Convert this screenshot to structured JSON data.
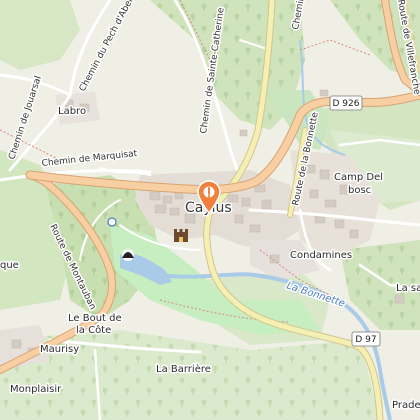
{
  "places": {
    "town": "Caylus",
    "labro": "Labro",
    "camp_del_bosc_1": "Camp Del",
    "camp_del_bosc_2": "bosc",
    "condamines": "Condamines",
    "le_bout_1": "Le Bout de",
    "le_bout_2": "la Côte",
    "maurisy": "Maurisy",
    "monplaisir": "Monplaisir",
    "la_barriere": "La Barrière",
    "prade": "Prade",
    "la_sa": "La sa",
    "que": "que"
  },
  "roads": {
    "d926": "D 926",
    "d97": "D 97",
    "chemin_marquisat": "Chemin de Marquisat",
    "chemin_jouarsal": "Chemin de Jouarsal",
    "chemin_pech": "Chemin du Pech d'Abel",
    "chemin_catherine": "Chemin de Sainte-Catherine",
    "route_bonnette": "Route de la Bonnette",
    "route_montauban": "Route de Montauban",
    "route_villefranche": "Route de Villefranche",
    "chemin_small": "Chemin"
  },
  "water": {
    "la_bonnette": "La Bonnette"
  },
  "marker": {
    "icon": "location-pin-icon",
    "color": "#f0803c"
  },
  "colors": {
    "forest": "#c9dfb5",
    "forest_dark": "#aed09a",
    "meadow": "#deeacf",
    "park": "#c8f2c2",
    "water": "#a7c9e6",
    "road_major": "#f5c99a",
    "road_secondary": "#f4ecb1",
    "built": "#e2dcd6",
    "building": "#d6cec6"
  }
}
